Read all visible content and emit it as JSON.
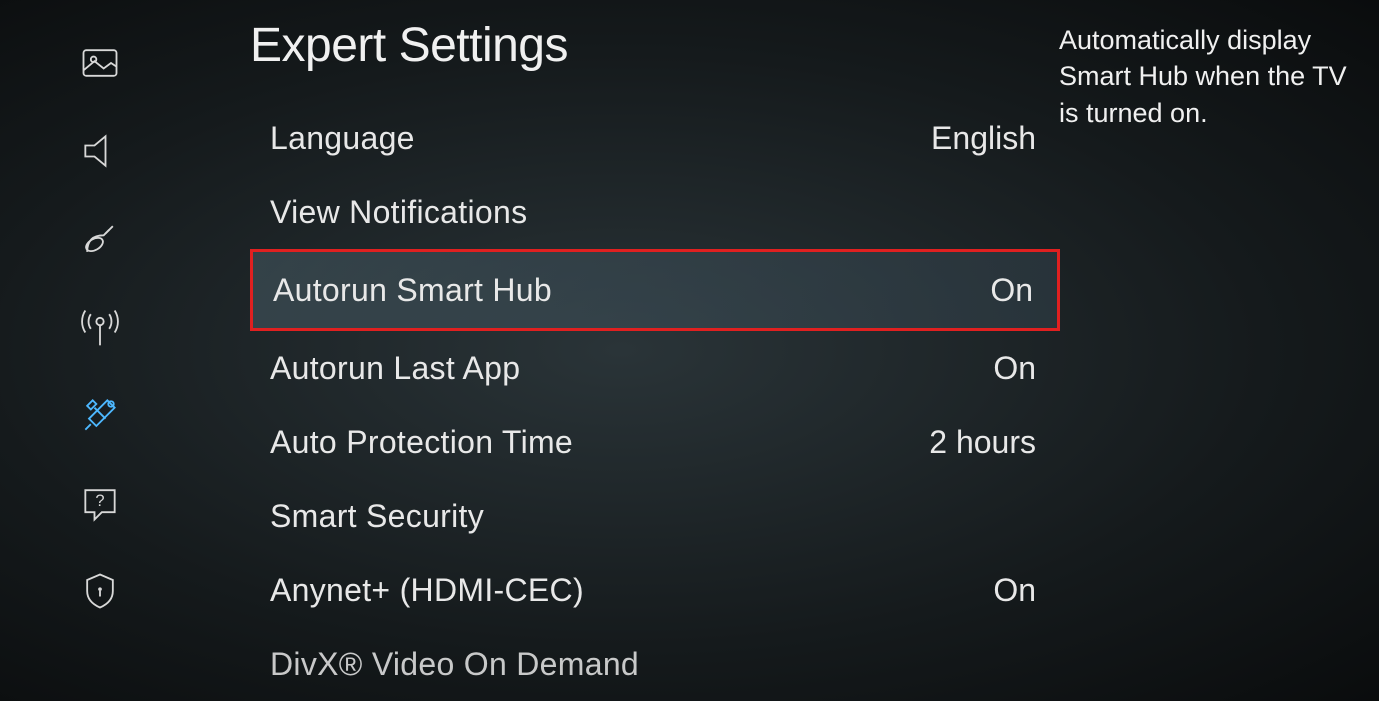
{
  "page_title": "Expert Settings",
  "description": "Automatically display Smart Hub when the TV is turned on.",
  "sidebar": {
    "items": [
      {
        "name": "picture"
      },
      {
        "name": "sound"
      },
      {
        "name": "broadcast"
      },
      {
        "name": "network"
      },
      {
        "name": "system",
        "active": true
      },
      {
        "name": "support"
      },
      {
        "name": "privacy"
      }
    ]
  },
  "settings": [
    {
      "label": "Language",
      "value": "English",
      "highlighted": false
    },
    {
      "label": "View Notifications",
      "value": "",
      "highlighted": false
    },
    {
      "label": "Autorun Smart Hub",
      "value": "On",
      "highlighted": true
    },
    {
      "label": "Autorun Last App",
      "value": "On",
      "highlighted": false
    },
    {
      "label": "Auto Protection Time",
      "value": "2 hours",
      "highlighted": false
    },
    {
      "label": "Smart Security",
      "value": "",
      "highlighted": false
    },
    {
      "label": "Anynet+ (HDMI-CEC)",
      "value": "On",
      "highlighted": false
    },
    {
      "label": "DivX® Video On Demand",
      "value": "",
      "highlighted": false
    }
  ]
}
